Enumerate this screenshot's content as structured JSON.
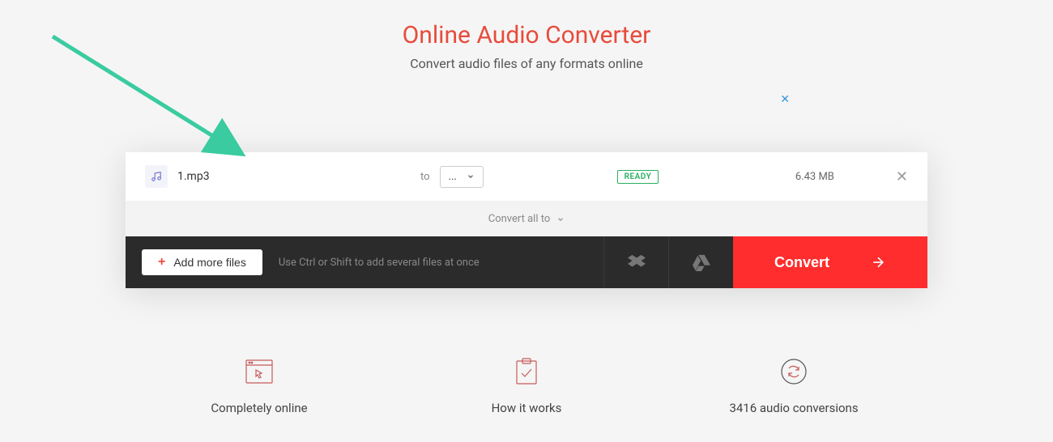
{
  "header": {
    "title": "Online Audio Converter",
    "subtitle": "Convert audio files of any formats online"
  },
  "file": {
    "name": "1.mp3",
    "to_label": "to",
    "format_value": "...",
    "status": "READY",
    "size": "6.43 MB"
  },
  "convert_all": {
    "label": "Convert all to"
  },
  "actions": {
    "add_more": "Add more files",
    "hint": "Use Ctrl or Shift to add several files at once",
    "convert": "Convert"
  },
  "features": {
    "f1": "Completely online",
    "f2": "How it works",
    "f3": "3416 audio conversions"
  }
}
